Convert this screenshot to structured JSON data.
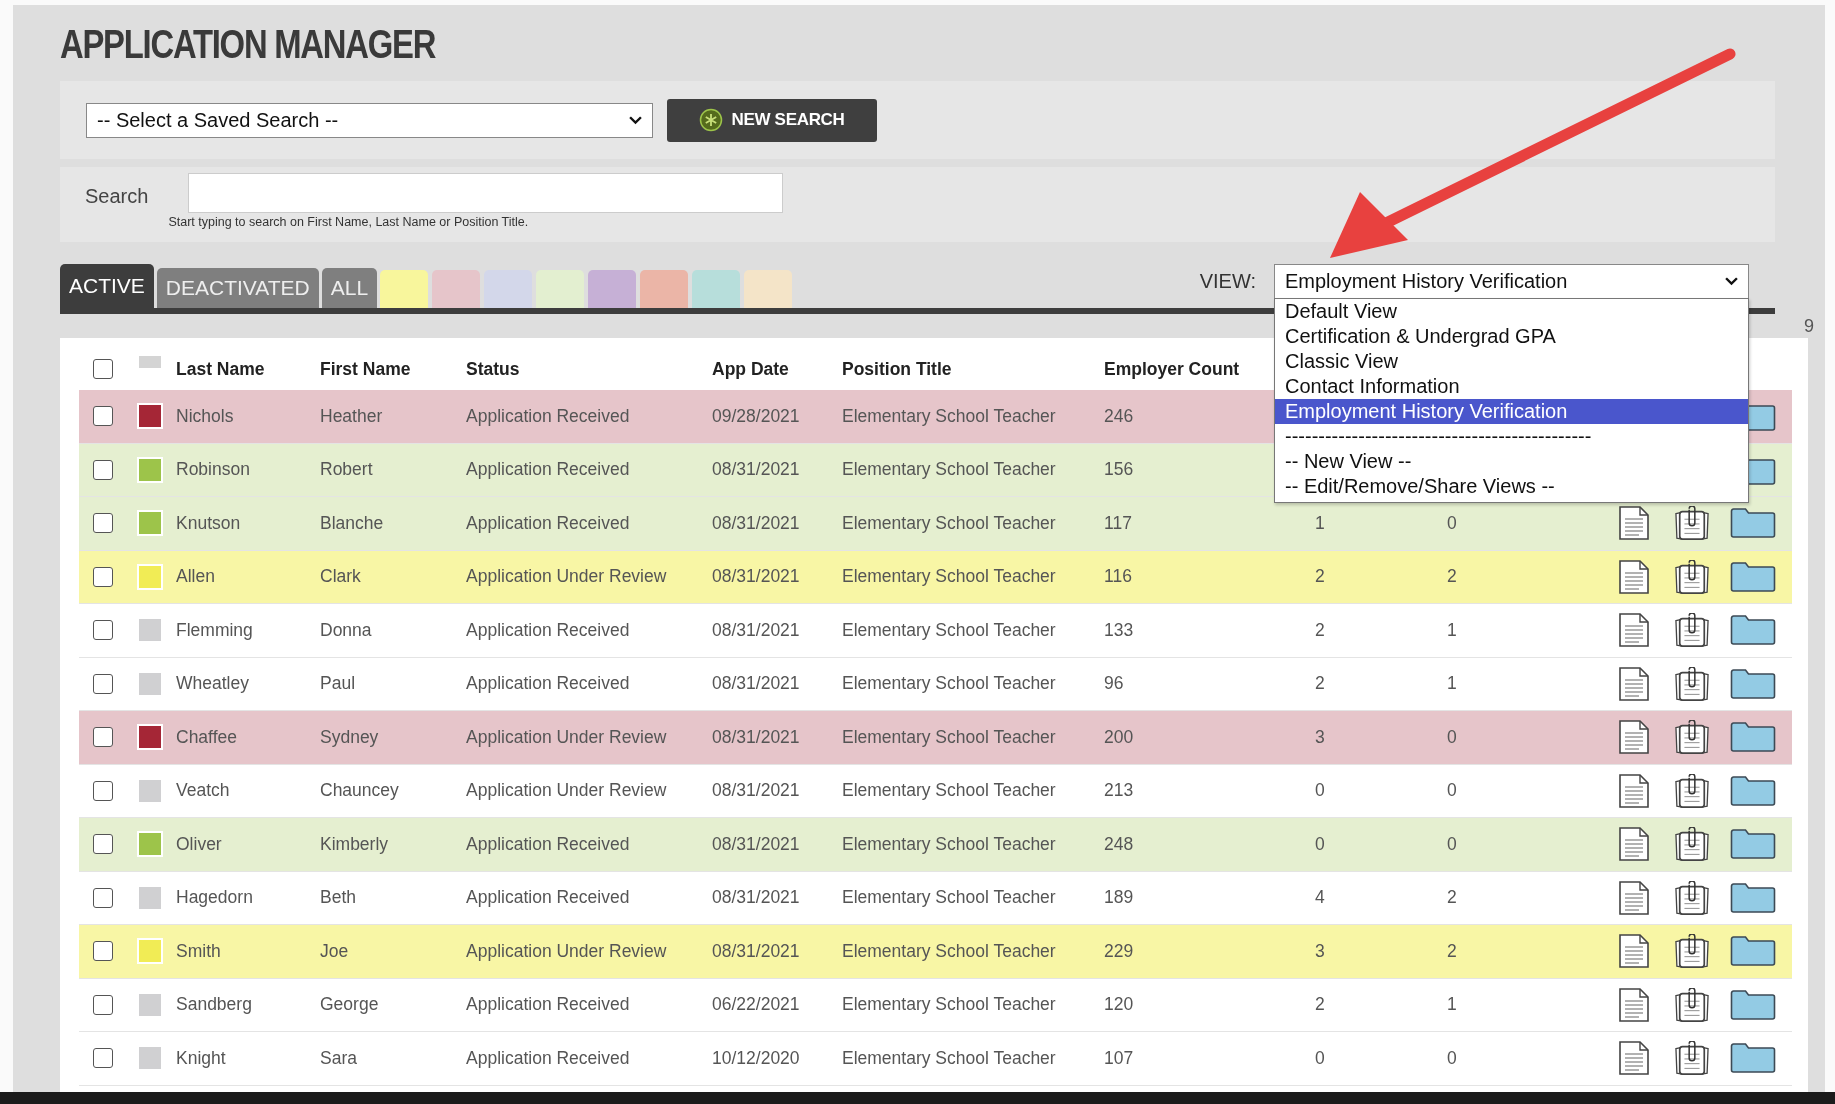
{
  "title": "APPLICATION MANAGER",
  "saved_search": {
    "value": "-- Select a Saved Search --"
  },
  "new_search_button": "NEW SEARCH",
  "search": {
    "label": "Search",
    "hint": "Start typing to search on First Name, Last Name or Position Title."
  },
  "tabs": [
    {
      "label": "ACTIVE",
      "selected": true
    },
    {
      "label": "DEACTIVATED",
      "selected": false
    },
    {
      "label": "ALL",
      "selected": false
    }
  ],
  "color_tabs": [
    {
      "color": "#f8f69c"
    },
    {
      "color": "#e6c5ca"
    },
    {
      "color": "#d3d7ea"
    },
    {
      "color": "#e3efd0"
    },
    {
      "color": "#c6b0d6"
    },
    {
      "color": "#ebb5a7"
    },
    {
      "color": "#b7dedb"
    },
    {
      "color": "#f4e4c8"
    }
  ],
  "view": {
    "label": "VIEW:",
    "value": "Employment History Verification",
    "options": [
      {
        "label": "Default View",
        "selected": false
      },
      {
        "label": "Certification & Undergrad GPA",
        "selected": false
      },
      {
        "label": "Classic View",
        "selected": false
      },
      {
        "label": "Contact Information",
        "selected": false
      },
      {
        "label": "Employment History Verification",
        "selected": true
      },
      {
        "label": "----------------------------------------------",
        "selected": false
      },
      {
        "label": "-- New View --",
        "selected": false
      },
      {
        "label": "-- Edit/Remove/Share Views --",
        "selected": false
      }
    ]
  },
  "page_count": "9",
  "table": {
    "columns": [
      "Last Name",
      "First Name",
      "Status",
      "App Date",
      "Position Title",
      "Employer Count"
    ],
    "header_checked": false,
    "rows": [
      {
        "checked": false,
        "color": "#a52636",
        "last_name": "Nichols",
        "first_name": "Heather",
        "status": "Application Received",
        "app_date": "09/28/2021",
        "position": "Elementary School Teacher",
        "employer_count": "246"
      },
      {
        "checked": false,
        "color": "#9dc44a",
        "last_name": "Robinson",
        "first_name": "Robert",
        "status": "Application Received",
        "app_date": "08/31/2021",
        "position": "Elementary School Teacher",
        "employer_count": "156"
      },
      {
        "checked": false,
        "color": "#9dc44a",
        "last_name": "Knutson",
        "first_name": "Blanche",
        "status": "Application Received",
        "app_date": "08/31/2021",
        "position": "Elementary School Teacher",
        "employer_count": "117",
        "column_8": "1",
        "column_9": "0"
      },
      {
        "checked": false,
        "color": "#f1ec55",
        "last_name": "Allen",
        "first_name": "Clark",
        "status": "Application Under Review",
        "app_date": "08/31/2021",
        "position": "Elementary School Teacher",
        "employer_count": "116",
        "column_8": "2",
        "column_9": "2"
      },
      {
        "checked": false,
        "color": "#d0d0d2",
        "last_name": "Flemming",
        "first_name": "Donna",
        "status": "Application Received",
        "app_date": "08/31/2021",
        "position": "Elementary School Teacher",
        "employer_count": "133",
        "column_8": "2",
        "column_9": "1"
      },
      {
        "checked": false,
        "color": "#d0d0d2",
        "last_name": "Wheatley",
        "first_name": "Paul",
        "status": "Application Received",
        "app_date": "08/31/2021",
        "position": "Elementary School Teacher",
        "employer_count": "96",
        "column_8": "2",
        "column_9": "1"
      },
      {
        "checked": false,
        "color": "#a52636",
        "last_name": "Chaffee",
        "first_name": "Sydney",
        "status": "Application Under Review",
        "app_date": "08/31/2021",
        "position": "Elementary School Teacher",
        "employer_count": "200",
        "column_8": "3",
        "column_9": "0"
      },
      {
        "checked": false,
        "color": "#d0d0d2",
        "last_name": "Veatch",
        "first_name": "Chauncey",
        "status": "Application Under Review",
        "app_date": "08/31/2021",
        "position": "Elementary School Teacher",
        "employer_count": "213",
        "column_8": "0",
        "column_9": "0"
      },
      {
        "checked": false,
        "color": "#9dc44a",
        "last_name": "Oliver",
        "first_name": "Kimberly",
        "status": "Application Received",
        "app_date": "08/31/2021",
        "position": "Elementary School Teacher",
        "employer_count": "248",
        "column_8": "0",
        "column_9": "0"
      },
      {
        "checked": false,
        "color": "#d0d0d2",
        "last_name": "Hagedorn",
        "first_name": "Beth",
        "status": "Application Received",
        "app_date": "08/31/2021",
        "position": "Elementary School Teacher",
        "employer_count": "189",
        "column_8": "4",
        "column_9": "2"
      },
      {
        "checked": false,
        "color": "#f1ec55",
        "last_name": "Smith",
        "first_name": "Joe",
        "status": "Application Under Review",
        "app_date": "08/31/2021",
        "position": "Elementary School Teacher",
        "employer_count": "229",
        "column_8": "3",
        "column_9": "2"
      },
      {
        "checked": false,
        "color": "#d0d0d2",
        "last_name": "Sandberg",
        "first_name": "George",
        "status": "Application Received",
        "app_date": "06/22/2021",
        "position": "Elementary School Teacher",
        "employer_count": "120",
        "column_8": "2",
        "column_9": "1"
      },
      {
        "checked": false,
        "color": "#d0d0d2",
        "last_name": "Knight",
        "first_name": "Sara",
        "status": "Application Received",
        "app_date": "10/12/2020",
        "position": "Elementary School Teacher",
        "employer_count": "107",
        "column_8": "0",
        "column_9": "0"
      }
    ]
  }
}
